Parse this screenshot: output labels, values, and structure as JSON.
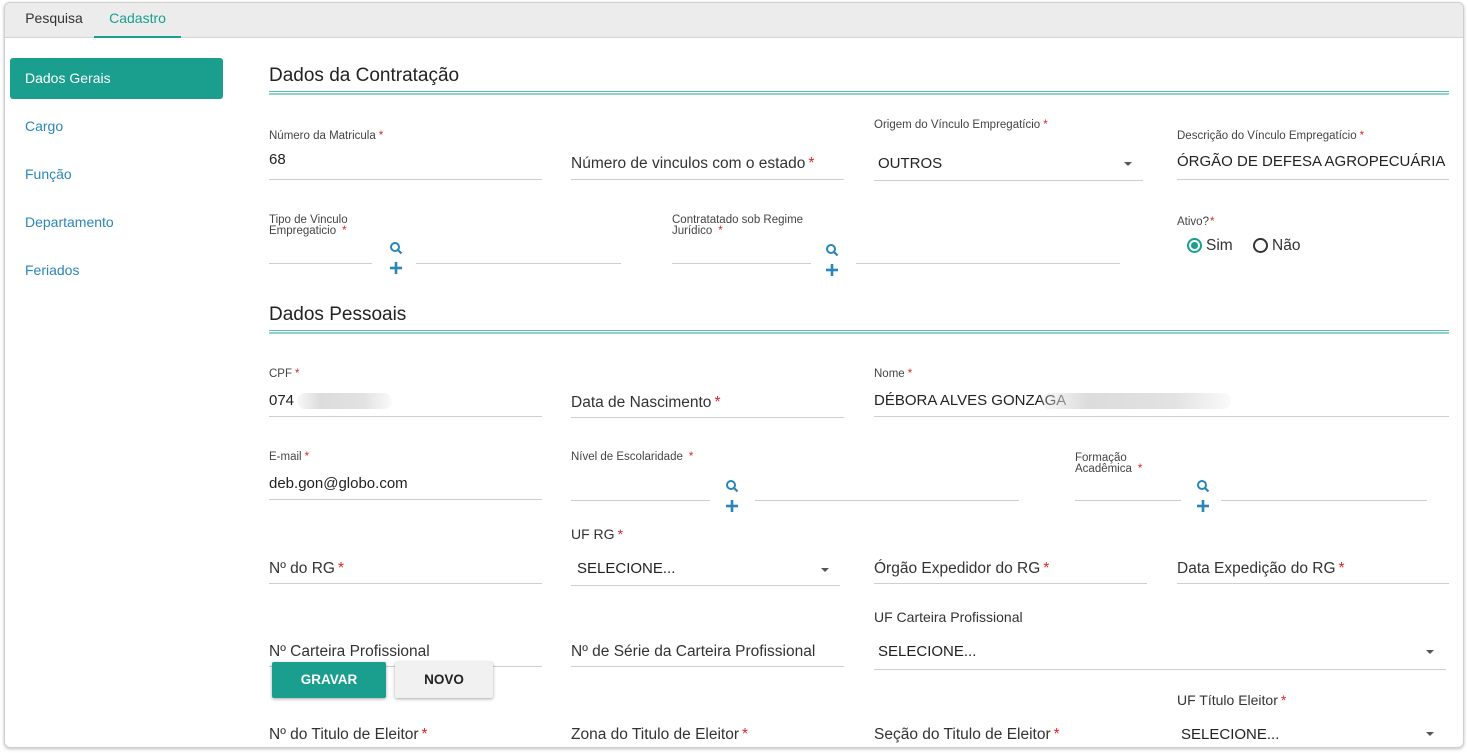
{
  "tabs": [
    "Pesquisa",
    "Cadastro"
  ],
  "sidebar": {
    "items": [
      "Dados Gerais",
      "Cargo",
      "Função",
      "Departamento",
      "Feriados"
    ]
  },
  "sections": {
    "contratacao": "Dados da Contratação",
    "pessoais": "Dados Pessoais"
  },
  "fields": {
    "matricula": {
      "label": "Número da Matricula",
      "value": "68"
    },
    "vinculos_estado": {
      "label": "Número de vinculos com o estado"
    },
    "origem_vinculo": {
      "label": "Origem do Vínculo Empregatício",
      "value": "OUTROS"
    },
    "descricao_vinculo": {
      "label": "Descrição do Vínculo Empregatício",
      "value": "ÓRGÃO DE DEFESA AGROPECUÁRIA"
    },
    "tipo_vinculo": {
      "label_l1": "Tipo de Vinculo",
      "label_l2": "Empregaticio"
    },
    "regime": {
      "label_l1": "Contratatado sob Regime",
      "label_l2": "Jurídico"
    },
    "ativo": {
      "label": "Ativo?",
      "options": [
        "Sim",
        "Não"
      ],
      "selected": "Sim"
    },
    "cpf": {
      "label": "CPF",
      "value": "074"
    },
    "nascimento": {
      "label": "Data de Nascimento"
    },
    "nome": {
      "label": "Nome",
      "value": "DÉBORA ALVES GONZAGA"
    },
    "email": {
      "label": "E-mail",
      "value": "deb.gon@globo.com"
    },
    "escolaridade": {
      "label": "Nível de Escolaridade"
    },
    "formacao": {
      "label_l1": "Formação",
      "label_l2": "Acadêmica"
    },
    "rg": {
      "label": "Nº do RG"
    },
    "uf_rg": {
      "label": "UF RG",
      "value": "SELECIONE..."
    },
    "orgao_rg": {
      "label": "Órgão Expedidor do RG"
    },
    "data_rg": {
      "label": "Data Expedição do RG"
    },
    "carteira": {
      "label": "Nº Carteira Profissional"
    },
    "serie_carteira": {
      "label": "Nº de Série da Carteira Profissional"
    },
    "uf_carteira": {
      "label": "UF Carteira Profissional",
      "value": "SELECIONE..."
    },
    "titulo": {
      "label": "Nº do Titulo de Eleitor"
    },
    "zona": {
      "label": "Zona do Titulo de Eleitor"
    },
    "secao": {
      "label": "Seção do Titulo de Eleitor"
    },
    "uf_titulo": {
      "label": "UF Título Eleitor",
      "value": "SELECIONE..."
    }
  },
  "buttons": {
    "gravar": "GRAVAR",
    "novo": "NOVO"
  },
  "required_mark": "*",
  "colors": {
    "accent": "#1a9e8e",
    "link": "#2a86b8",
    "required": "#d9262c"
  },
  "icons": [
    "search-icon",
    "plus-icon",
    "chevron-down-icon"
  ]
}
